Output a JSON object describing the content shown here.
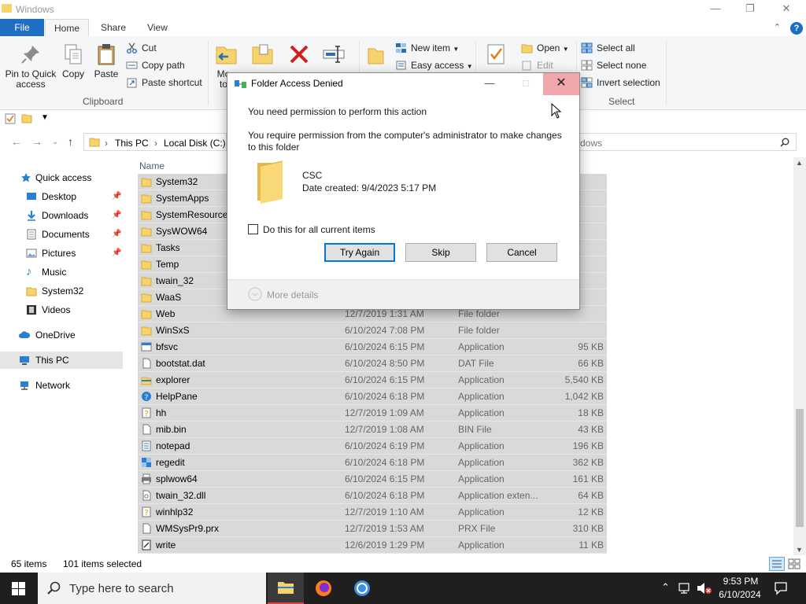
{
  "window": {
    "title": "Windows"
  },
  "ribbon": {
    "tabs": [
      "File",
      "Home",
      "Share",
      "View"
    ],
    "clipboard": {
      "pin_label": "Pin to Quick access",
      "copy_label": "Copy",
      "paste_label": "Paste",
      "cut_label": "Cut",
      "copy_path_label": "Copy path",
      "paste_shortcut_label": "Paste shortcut",
      "group_label": "Clipboard"
    },
    "organize": {
      "move_label_1": "Mo",
      "move_label_2": "to"
    },
    "new": {
      "new_item_label": "New item",
      "easy_access_label": "Easy access"
    },
    "open": {
      "open_label": "Open",
      "edit_label": "Edit"
    },
    "select": {
      "select_all_label": "Select all",
      "select_none_label": "Select none",
      "invert_label": "Invert selection",
      "group_label": "Select"
    }
  },
  "address": {
    "crumbs": [
      "This PC",
      "Local Disk (C:)"
    ],
    "search_placeholder": "dows"
  },
  "nav": {
    "quick_access": "Quick access",
    "items": [
      {
        "label": "Desktop",
        "pinned": true
      },
      {
        "label": "Downloads",
        "pinned": true
      },
      {
        "label": "Documents",
        "pinned": true
      },
      {
        "label": "Pictures",
        "pinned": true
      },
      {
        "label": "Music",
        "pinned": false
      },
      {
        "label": "System32",
        "pinned": false
      },
      {
        "label": "Videos",
        "pinned": false
      }
    ],
    "onedrive": "OneDrive",
    "this_pc": "This PC",
    "network": "Network"
  },
  "filelist": {
    "col_name": "Name",
    "rows": [
      {
        "name": "System32",
        "date": "",
        "type": "",
        "size": "",
        "kind": "folder"
      },
      {
        "name": "SystemApps",
        "date": "",
        "type": "",
        "size": "",
        "kind": "folder"
      },
      {
        "name": "SystemResources",
        "date": "",
        "type": "",
        "size": "",
        "kind": "folder"
      },
      {
        "name": "SysWOW64",
        "date": "",
        "type": "",
        "size": "",
        "kind": "folder"
      },
      {
        "name": "Tasks",
        "date": "",
        "type": "",
        "size": "",
        "kind": "folder"
      },
      {
        "name": "Temp",
        "date": "",
        "type": "",
        "size": "",
        "kind": "folder"
      },
      {
        "name": "twain_32",
        "date": "",
        "type": "",
        "size": "",
        "kind": "folder"
      },
      {
        "name": "WaaS",
        "date": "",
        "type": "",
        "size": "",
        "kind": "folder"
      },
      {
        "name": "Web",
        "date": "12/7/2019 1:31 AM",
        "type": "File folder",
        "size": "",
        "kind": "folder"
      },
      {
        "name": "WinSxS",
        "date": "6/10/2024 7:08 PM",
        "type": "File folder",
        "size": "",
        "kind": "folder"
      },
      {
        "name": "bfsvc",
        "date": "6/10/2024 6:15 PM",
        "type": "Application",
        "size": "95 KB",
        "kind": "app"
      },
      {
        "name": "bootstat.dat",
        "date": "6/10/2024 8:50 PM",
        "type": "DAT File",
        "size": "66 KB",
        "kind": "file"
      },
      {
        "name": "explorer",
        "date": "6/10/2024 6:15 PM",
        "type": "Application",
        "size": "5,540 KB",
        "kind": "explorer"
      },
      {
        "name": "HelpPane",
        "date": "6/10/2024 6:18 PM",
        "type": "Application",
        "size": "1,042 KB",
        "kind": "help"
      },
      {
        "name": "hh",
        "date": "12/7/2019 1:09 AM",
        "type": "Application",
        "size": "18 KB",
        "kind": "hh"
      },
      {
        "name": "mib.bin",
        "date": "12/7/2019 1:08 AM",
        "type": "BIN File",
        "size": "43 KB",
        "kind": "file"
      },
      {
        "name": "notepad",
        "date": "6/10/2024 6:19 PM",
        "type": "Application",
        "size": "196 KB",
        "kind": "notepad"
      },
      {
        "name": "regedit",
        "date": "6/10/2024 6:18 PM",
        "type": "Application",
        "size": "362 KB",
        "kind": "regedit"
      },
      {
        "name": "splwow64",
        "date": "6/10/2024 6:15 PM",
        "type": "Application",
        "size": "161 KB",
        "kind": "printer"
      },
      {
        "name": "twain_32.dll",
        "date": "6/10/2024 6:18 PM",
        "type": "Application exten...",
        "size": "64 KB",
        "kind": "dll"
      },
      {
        "name": "winhlp32",
        "date": "12/7/2019 1:10 AM",
        "type": "Application",
        "size": "12 KB",
        "kind": "hh"
      },
      {
        "name": "WMSysPr9.prx",
        "date": "12/7/2019 1:53 AM",
        "type": "PRX File",
        "size": "310 KB",
        "kind": "file"
      },
      {
        "name": "write",
        "date": "12/6/2019 1:29 PM",
        "type": "Application",
        "size": "11 KB",
        "kind": "write"
      }
    ]
  },
  "status": {
    "items": "65 items",
    "selected": "101 items selected"
  },
  "dialog": {
    "title": "Folder Access Denied",
    "headline": "You need permission to perform this action",
    "body": "You require permission from the computer's administrator to make changes to this folder",
    "folder_name": "CSC",
    "date_created": "Date created: 9/4/2023 5:17 PM",
    "checkbox_label": "Do this for all current items",
    "try_again": "Try Again",
    "skip": "Skip",
    "cancel": "Cancel",
    "more_details": "More details"
  },
  "taskbar": {
    "search_placeholder": "Type here to search",
    "time": "9:53 PM",
    "date": "6/10/2024"
  }
}
